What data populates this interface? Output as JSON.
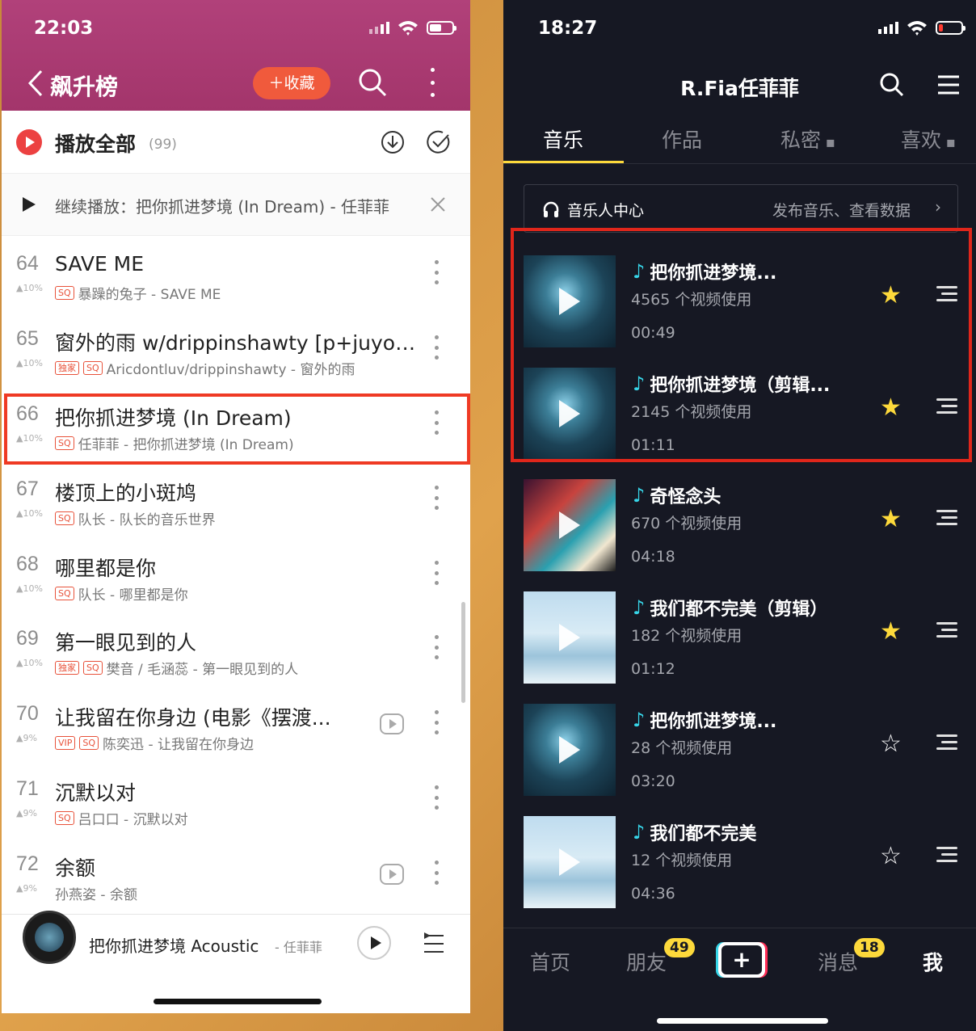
{
  "left": {
    "status_time": "22:03",
    "title": "飙升榜",
    "collect_label": "＋收藏",
    "play_all_label": "播放全部",
    "play_all_count": "(99)",
    "continue_label": "继续播放：把你抓进梦境 (In Dream) - 任菲菲",
    "rows": [
      {
        "num": "64",
        "pct": "▲10%",
        "title": "SAVE ME",
        "tags": [
          "SQ"
        ],
        "sub": "暴躁的兔子 - SAVE ME"
      },
      {
        "num": "65",
        "pct": "▲10%",
        "title": "窗外的雨 w/drippinshawty [p+juyout...",
        "tags": [
          "独家",
          "SQ"
        ],
        "sub": "Aricdontluv/drippinshawty - 窗外的雨"
      },
      {
        "num": "66",
        "pct": "▲10%",
        "title": "把你抓进梦境 (In Dream)",
        "tags": [
          "SQ"
        ],
        "sub": "任菲菲 - 把你抓进梦境 (In Dream)"
      },
      {
        "num": "67",
        "pct": "▲10%",
        "title": "楼顶上的小斑鸠",
        "tags": [
          "SQ"
        ],
        "sub": "队长 - 队长的音乐世界"
      },
      {
        "num": "68",
        "pct": "▲10%",
        "title": "哪里都是你",
        "tags": [
          "SQ"
        ],
        "sub": "队长 - 哪里都是你"
      },
      {
        "num": "69",
        "pct": "▲10%",
        "title": "第一眼见到的人",
        "tags": [
          "独家",
          "SQ"
        ],
        "sub": "樊音 / 毛涵蕊 - 第一眼见到的人"
      },
      {
        "num": "70",
        "pct": "▲9%",
        "title": "让我留在你身边 (电影《摆渡...",
        "tags": [
          "VIP",
          "SQ"
        ],
        "sub": "陈奕迅 - 让我留在你身边"
      },
      {
        "num": "71",
        "pct": "▲9%",
        "title": "沉默以对",
        "tags": [
          "SQ"
        ],
        "sub": "吕口口 - 沉默以对"
      },
      {
        "num": "72",
        "pct": "▲9%",
        "title": "余额",
        "tags": [],
        "sub": "孙燕姿 - 余额"
      }
    ],
    "now_playing": {
      "title": "把你抓进梦境 Acoustic",
      "artist": "- 任菲菲"
    }
  },
  "right": {
    "status_time": "18:27",
    "profile_name": "R.Fia任菲菲",
    "tabs": [
      "音乐",
      "作品",
      "私密",
      "喜欢"
    ],
    "music_center_label": "音乐人中心",
    "music_center_link": "发布音乐、查看数据",
    "songs": [
      {
        "title": "把你抓进梦境...",
        "uses": "4565 个视频使用",
        "duration": "00:49",
        "starred": true
      },
      {
        "title": "把你抓进梦境（剪辑...",
        "uses": "2145 个视频使用",
        "duration": "01:11",
        "starred": true
      },
      {
        "title": "奇怪念头",
        "uses": "670 个视频使用",
        "duration": "04:18",
        "starred": true
      },
      {
        "title": "我们都不完美（剪辑）",
        "uses": "182 个视频使用",
        "duration": "01:12",
        "starred": true
      },
      {
        "title": "把你抓进梦境...",
        "uses": "28 个视频使用",
        "duration": "03:20",
        "starred": false
      },
      {
        "title": "我们都不完美",
        "uses": "12 个视频使用",
        "duration": "04:36",
        "starred": false
      }
    ],
    "bottom_nav": {
      "home": "首页",
      "friends": "朋友",
      "friends_badge": "49",
      "messages": "消息",
      "messages_badge": "18",
      "me": "我"
    }
  },
  "colors": {
    "left_header": "#a8386e",
    "accent_red": "#ec4141",
    "highlight_box": "#e0261b",
    "dark_bg": "#161823",
    "tab_underline": "#fdd93b",
    "note_cyan": "#37d5e8"
  }
}
